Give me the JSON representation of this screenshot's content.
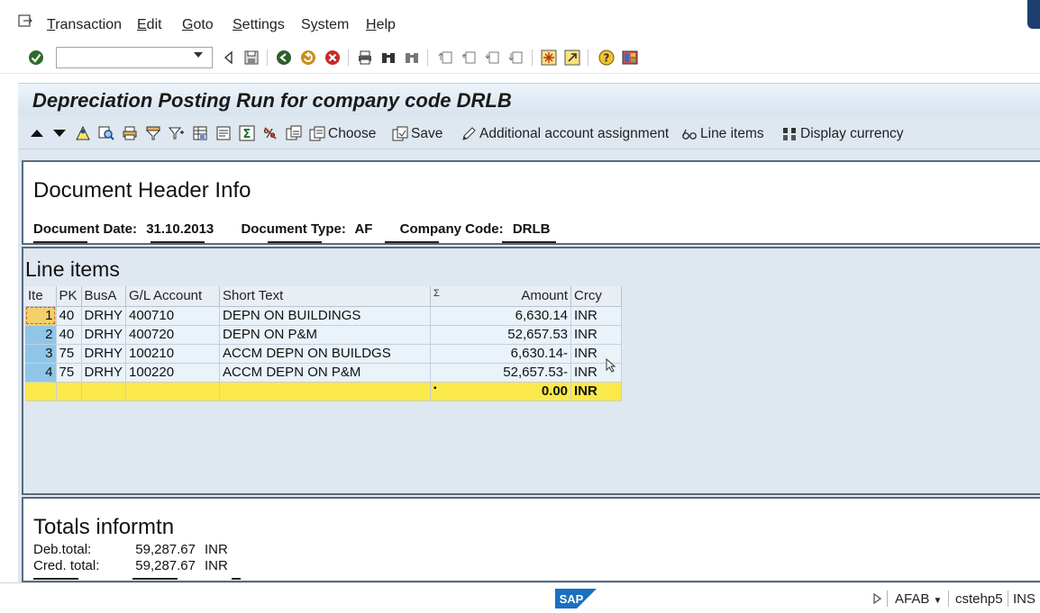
{
  "menu": {
    "items": [
      {
        "label": "Transaction",
        "u": "T",
        "rest": "ransaction"
      },
      {
        "label": "Edit",
        "u": "E",
        "rest": "dit"
      },
      {
        "label": "Goto",
        "u": "G",
        "rest": "oto"
      },
      {
        "label": "Settings",
        "u": "S",
        "rest": "ettings"
      },
      {
        "label": "System",
        "u": "y",
        "pre": "S",
        "rest": "stem"
      },
      {
        "label": "Help",
        "u": "H",
        "rest": "elp"
      }
    ]
  },
  "command_field": {
    "value": ""
  },
  "screen": {
    "title": "Depreciation Posting Run for company code DRLB"
  },
  "app_toolbar": {
    "choose_label": "Choose",
    "save_label": "Save",
    "additional_label": "Additional account assignment",
    "line_items_label": "Line items",
    "display_currency_label": "Display currency"
  },
  "doc_header": {
    "title": "Document Header Info",
    "document_date_label": "Document Date:",
    "document_date": "31.10.2013",
    "document_type_label": "Document Type:",
    "document_type": "AF",
    "company_code_label": "Company Code:",
    "company_code": "DRLB"
  },
  "line_items": {
    "title": "Line items",
    "columns": {
      "item": "Ite",
      "pk": "PK",
      "busa": "BusA",
      "gl": "G/L Account",
      "text": "Short Text",
      "sigma": "Σ",
      "amount": "Amount",
      "crcy": "Crcy"
    },
    "rows": [
      {
        "item": "1",
        "pk": "40",
        "busa": "DRHY",
        "gl": "400710",
        "text": "DEPN ON BUILDINGS",
        "amount": "6,630.14",
        "crcy": "INR"
      },
      {
        "item": "2",
        "pk": "40",
        "busa": "DRHY",
        "gl": "400720",
        "text": "DEPN ON P&M",
        "amount": "52,657.53",
        "crcy": "INR"
      },
      {
        "item": "3",
        "pk": "75",
        "busa": "DRHY",
        "gl": "100210",
        "text": "ACCM DEPN ON BUILDGS",
        "amount": "6,630.14-",
        "crcy": "INR"
      },
      {
        "item": "4",
        "pk": "75",
        "busa": "DRHY",
        "gl": "100220",
        "text": "ACCM DEPN ON P&M",
        "amount": "52,657.53-",
        "crcy": "INR"
      }
    ],
    "total": {
      "marker": "▪",
      "amount": "0.00",
      "crcy": "INR"
    }
  },
  "totals": {
    "title": "Totals informtn",
    "debit_label": "Deb.total:",
    "debit_value": "59,287.67",
    "debit_crcy": "INR",
    "credit_label": "Cred. total:",
    "credit_value": "59,287.67",
    "credit_crcy": "INR"
  },
  "status_bar": {
    "logo": "SAP",
    "transaction": "AFAB",
    "server": "cstehp5",
    "mode": "INS"
  },
  "colors": {
    "screen_bg": "#dfe8f1",
    "total_row": "#fbe94a",
    "selected_cell": "#8fc6e8",
    "sap_blue": "#1a6fc0"
  }
}
